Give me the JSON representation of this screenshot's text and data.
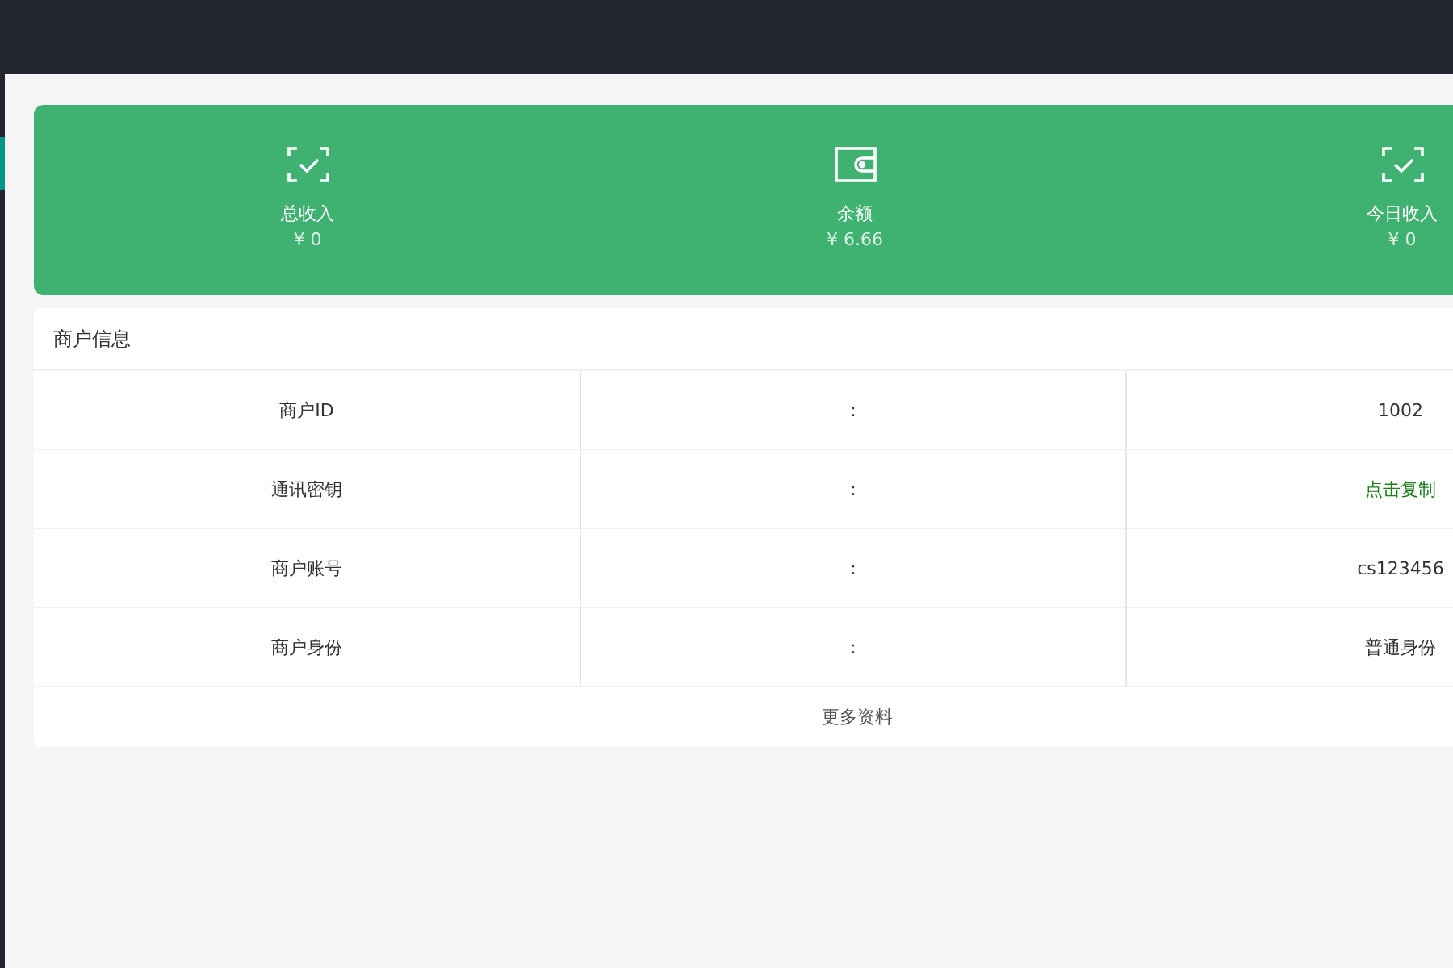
{
  "stats": [
    {
      "kind": "scan",
      "label": "总收入",
      "value": "¥ 0"
    },
    {
      "kind": "wallet",
      "label": "余额",
      "value": "¥ 6.66"
    },
    {
      "kind": "scan",
      "label": "今日收入",
      "value": "¥ 0"
    }
  ],
  "merchant_info": {
    "title": "商户信息",
    "rows": [
      {
        "label": "商户ID",
        "separator": ":",
        "value": "1002",
        "kind": "text"
      },
      {
        "label": "通讯密钥",
        "separator": ":",
        "value": "点击复制",
        "kind": "link"
      },
      {
        "label": "商户账号",
        "separator": ":",
        "value": "cs123456",
        "kind": "text"
      },
      {
        "label": "商户身份",
        "separator": ":",
        "value": "普通身份",
        "kind": "text"
      }
    ],
    "more_link": "更多资料"
  }
}
